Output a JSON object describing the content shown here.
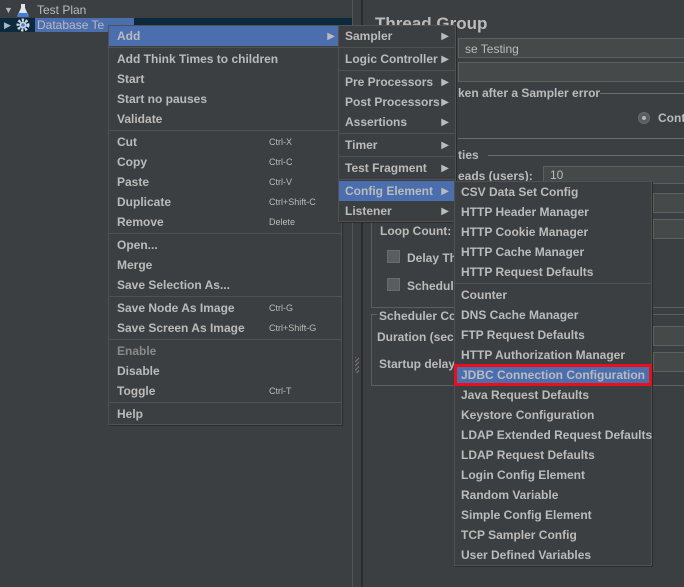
{
  "tree": {
    "items": [
      {
        "label": "Test Plan",
        "icon": "flask-icon",
        "expanded": true
      },
      {
        "label": "Database Te",
        "icon": "gear-icon",
        "expanded": false,
        "selected": true
      }
    ]
  },
  "right_panel": {
    "title": "Thread Group",
    "name_value": "se Testing",
    "comments_value": "",
    "error_action_label": "ken after a Sampler error",
    "radio_continue_label": "Conti",
    "thread_props_label": "ties",
    "threads_label": "eads (users):",
    "threads_value": "10",
    "loop_count_label": "Loop Count:",
    "delay_label": "Delay Thr",
    "scheduler_label": "Schedule",
    "scheduler_config_label": "Scheduler Co",
    "duration_label": "Duration (secc",
    "startup_delay_label": "Startup delay"
  },
  "context_menu": {
    "items": [
      {
        "label": "Add",
        "submenu": true,
        "active": true
      },
      {
        "separator": true
      },
      {
        "label": "Add Think Times to children"
      },
      {
        "label": "Start"
      },
      {
        "label": "Start no pauses"
      },
      {
        "label": "Validate"
      },
      {
        "separator": true
      },
      {
        "label": "Cut",
        "accel": "Ctrl-X"
      },
      {
        "label": "Copy",
        "accel": "Ctrl-C"
      },
      {
        "label": "Paste",
        "accel": "Ctrl-V"
      },
      {
        "label": "Duplicate",
        "accel": "Ctrl+Shift-C"
      },
      {
        "label": "Remove",
        "accel": "Delete"
      },
      {
        "separator": true
      },
      {
        "label": "Open..."
      },
      {
        "label": "Merge"
      },
      {
        "label": "Save Selection As..."
      },
      {
        "separator": true
      },
      {
        "label": "Save Node As Image",
        "accel": "Ctrl-G"
      },
      {
        "label": "Save Screen As Image",
        "accel": "Ctrl+Shift-G"
      },
      {
        "separator": true
      },
      {
        "label": "Enable",
        "disabled": true
      },
      {
        "label": "Disable"
      },
      {
        "label": "Toggle",
        "accel": "Ctrl-T"
      },
      {
        "separator": true
      },
      {
        "label": "Help"
      }
    ]
  },
  "add_submenu": {
    "items": [
      {
        "label": "Sampler",
        "submenu": true
      },
      {
        "separator": true
      },
      {
        "label": "Logic Controller",
        "submenu": true
      },
      {
        "separator": true
      },
      {
        "label": "Pre Processors",
        "submenu": true
      },
      {
        "label": "Post Processors",
        "submenu": true
      },
      {
        "label": "Assertions",
        "submenu": true
      },
      {
        "separator": true
      },
      {
        "label": "Timer",
        "submenu": true
      },
      {
        "separator": true
      },
      {
        "label": "Test Fragment",
        "submenu": true
      },
      {
        "separator": true
      },
      {
        "label": "Config Element",
        "submenu": true,
        "active": true
      },
      {
        "label": "Listener",
        "submenu": true
      }
    ]
  },
  "config_submenu": {
    "items": [
      {
        "label": "CSV Data Set Config"
      },
      {
        "label": "HTTP Header Manager"
      },
      {
        "label": "HTTP Cookie Manager"
      },
      {
        "label": "HTTP Cache Manager"
      },
      {
        "label": "HTTP Request Defaults"
      },
      {
        "separator": true
      },
      {
        "label": "Counter"
      },
      {
        "label": "DNS Cache Manager"
      },
      {
        "label": "FTP Request Defaults"
      },
      {
        "label": "HTTP Authorization Manager"
      },
      {
        "label": "JDBC Connection Configuration",
        "highlight": true
      },
      {
        "label": "Java Request Defaults"
      },
      {
        "label": "Keystore Configuration"
      },
      {
        "label": "LDAP Extended Request Defaults"
      },
      {
        "label": "LDAP Request Defaults"
      },
      {
        "label": "Login Config Element"
      },
      {
        "label": "Random Variable"
      },
      {
        "label": "Simple Config Element"
      },
      {
        "label": "TCP Sampler Config"
      },
      {
        "label": "User Defined Variables"
      }
    ]
  },
  "colors": {
    "background": "#3c3f41",
    "selection": "#4b6eaf",
    "highlight_border": "#e8101a",
    "text": "#bbbbbb"
  }
}
